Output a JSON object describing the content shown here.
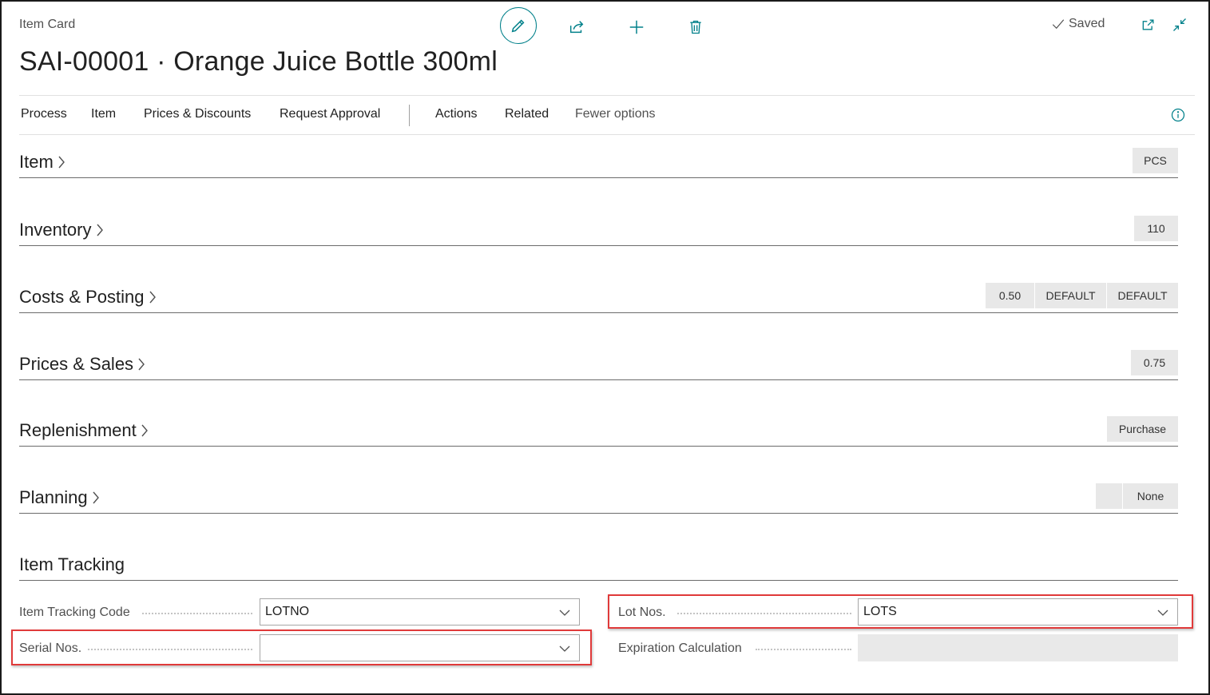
{
  "header": {
    "breadcrumb": "Item Card",
    "title": "SAI-00001 · Orange Juice Bottle 300ml",
    "saved_label": "Saved"
  },
  "actionbar": {
    "items": [
      "Process",
      "Item",
      "Prices & Discounts",
      "Request Approval",
      "Actions",
      "Related",
      "Fewer options"
    ]
  },
  "fasttabs": [
    {
      "title": "Item",
      "values": [
        "PCS"
      ]
    },
    {
      "title": "Inventory",
      "values": [
        "110"
      ]
    },
    {
      "title": "Costs & Posting",
      "values": [
        "0.50",
        "DEFAULT",
        "DEFAULT"
      ]
    },
    {
      "title": "Prices & Sales",
      "values": [
        "0.75"
      ]
    },
    {
      "title": "Replenishment",
      "values": [
        "Purchase"
      ]
    },
    {
      "title": "Planning",
      "values": [
        "",
        "None"
      ]
    }
  ],
  "item_tracking": {
    "title": "Item Tracking",
    "item_tracking_code": {
      "label": "Item Tracking Code",
      "value": "LOTNO"
    },
    "serial_nos": {
      "label": "Serial Nos.",
      "value": ""
    },
    "lot_nos": {
      "label": "Lot Nos.",
      "value": "LOTS"
    },
    "expiration_calculation": {
      "label": "Expiration Calculation",
      "value": ""
    }
  },
  "colors": {
    "accent": "#00808a",
    "highlight": "#e03a3a"
  }
}
